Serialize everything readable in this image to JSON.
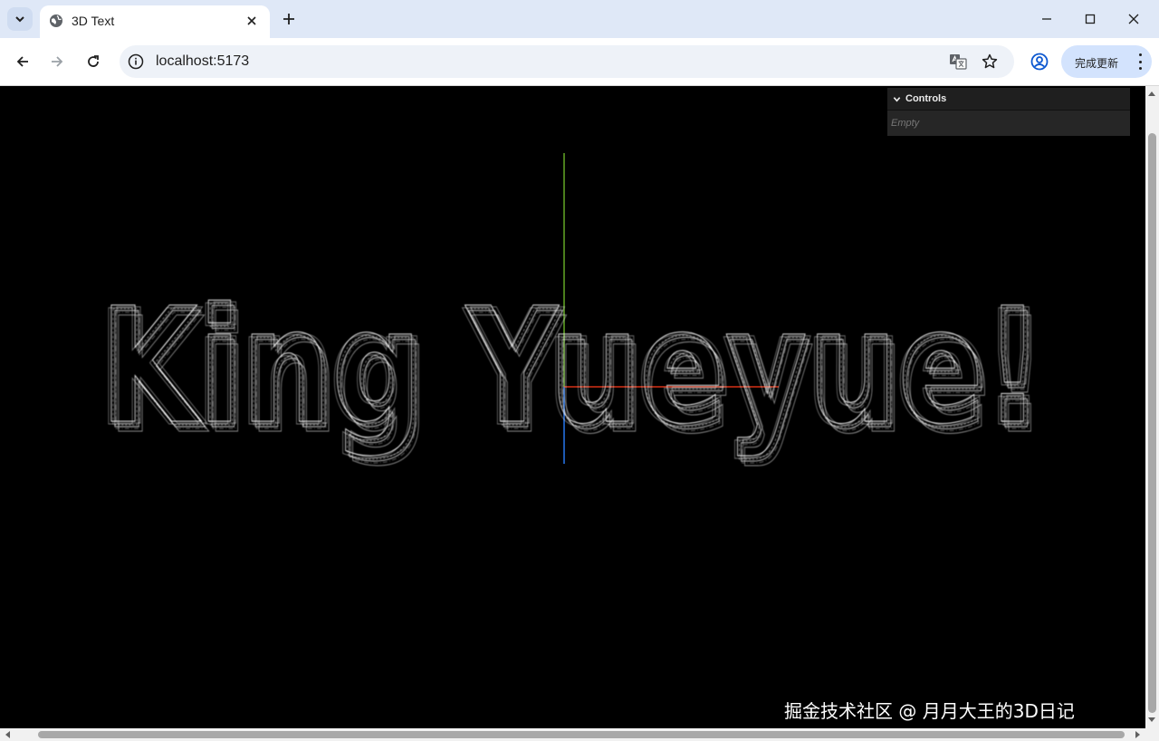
{
  "browser": {
    "tab": {
      "title": "3D Text"
    },
    "address": {
      "url": "localhost:5173"
    },
    "update_button": {
      "label": "完成更新"
    }
  },
  "gui": {
    "title": "Controls",
    "empty_text": "Empty"
  },
  "scene": {
    "text": "King Yueyue!",
    "render_mode": "wireframe",
    "text_color": "#ffffff",
    "background_color": "#000000",
    "axes_colors": {
      "x": "#ff3b1a",
      "y": "#7bd12e",
      "z": "#2a7fff"
    }
  },
  "watermark": {
    "text": "掘金技术社区 @ 月月大王的3D日记"
  }
}
